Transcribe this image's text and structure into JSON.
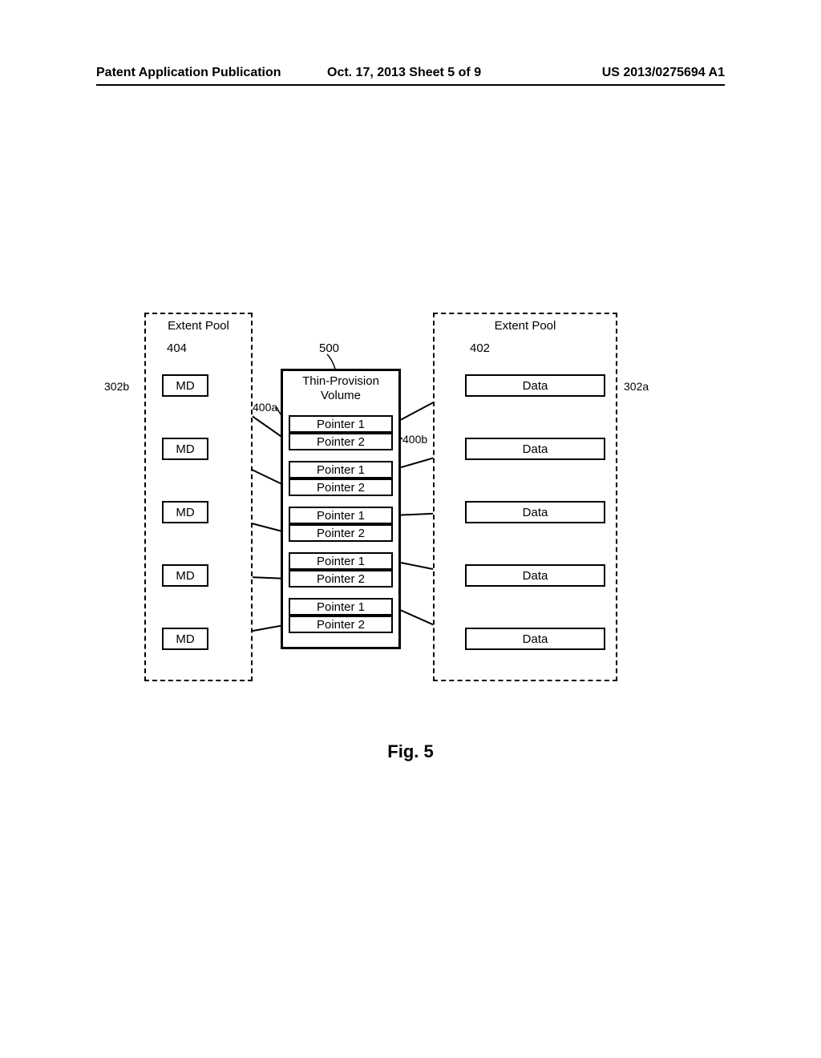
{
  "header": {
    "left": "Patent Application Publication",
    "center": "Oct. 17, 2013  Sheet 5 of 9",
    "right": "US 2013/0275694 A1"
  },
  "figure_caption": "Fig. 5",
  "left_pool": {
    "title": "Extent Pool",
    "ref": "404",
    "boxes": [
      "MD",
      "MD",
      "MD",
      "MD",
      "MD"
    ]
  },
  "right_pool": {
    "title": "Extent Pool",
    "ref": "402",
    "boxes": [
      "Data",
      "Data",
      "Data",
      "Data",
      "Data"
    ]
  },
  "center_group": {
    "title": "Thin-Provision Volume",
    "ref": "500",
    "rows": [
      {
        "p1": "Pointer 1",
        "p2": "Pointer 2"
      },
      {
        "p1": "Pointer 1",
        "p2": "Pointer 2"
      },
      {
        "p1": "Pointer 1",
        "p2": "Pointer 2"
      },
      {
        "p1": "Pointer 1",
        "p2": "Pointer 2"
      },
      {
        "p1": "Pointer 1",
        "p2": "Pointer 2"
      }
    ]
  },
  "annotations": {
    "left_side": "302b",
    "right_side": "302a",
    "ptr1_lead": "400a",
    "ptr2_lead": "400b"
  }
}
